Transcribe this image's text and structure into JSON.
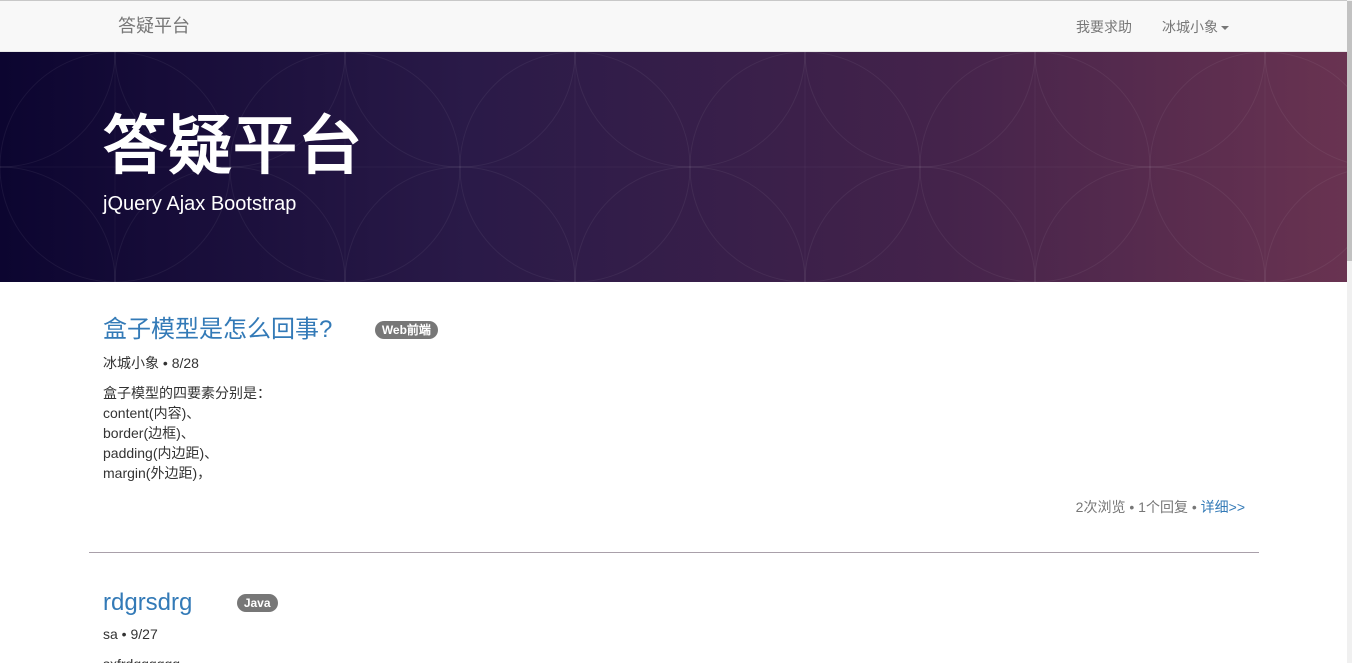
{
  "navbar": {
    "brand": "答疑平台",
    "help_link": "我要求助",
    "user_menu": "冰城小象"
  },
  "hero": {
    "title": "答疑平台",
    "subtitle": "jQuery Ajax Bootstrap"
  },
  "posts": [
    {
      "title": "盒子模型是怎么回事?",
      "tag": "Web前端",
      "author": "冰城小象",
      "date": "8/28",
      "body_lines": [
        "盒子模型的四要素分别是：",
        "content(内容)、",
        "border(边框)、",
        "padding(内边距)、",
        "margin(外边距)，"
      ],
      "views": "2次浏览",
      "replies": "1个回复",
      "detail": "详细>>"
    },
    {
      "title": "rdgrsdrg",
      "tag": "Java",
      "author": "sa",
      "date": "9/27",
      "body_lines": [
        "sxfrdgggggg"
      ]
    }
  ],
  "separator": " • "
}
